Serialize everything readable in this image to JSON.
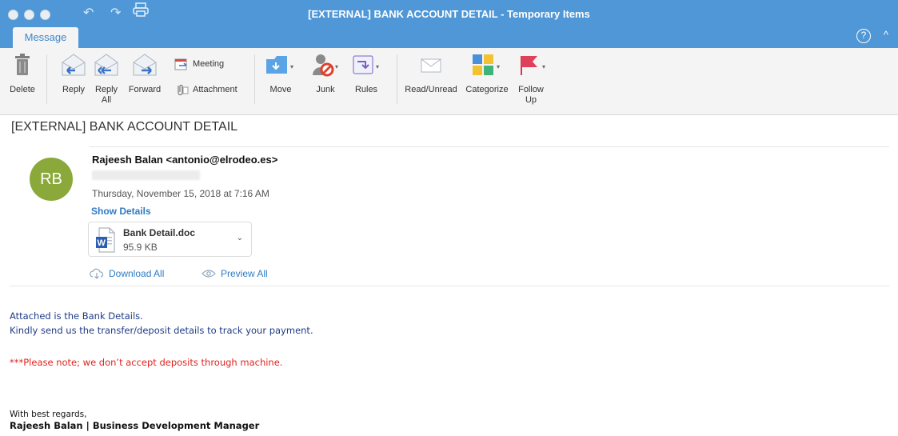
{
  "window": {
    "title": "[EXTERNAL] BANK ACCOUNT DETAIL - Temporary Items",
    "tab_label": "Message",
    "help_glyph": "?",
    "collapse_glyph": "^"
  },
  "ribbon": {
    "delete": "Delete",
    "reply": "Reply",
    "reply_all": "Reply All",
    "forward": "Forward",
    "meeting": "Meeting",
    "attachment": "Attachment",
    "move": "Move",
    "junk": "Junk",
    "rules": "Rules",
    "read_unread": "Read/Unread",
    "categorize": "Categorize",
    "follow_up": "Follow Up"
  },
  "message": {
    "subject": "[EXTERNAL] BANK ACCOUNT DETAIL",
    "avatar_initials": "RB",
    "sender": "Rajeesh Balan <antonio@elrodeo.es>",
    "date": "Thursday, November 15, 2018 at 7:16 AM",
    "show_details": "Show Details",
    "attachment_name": "Bank Detail.doc",
    "attachment_size": "95.9 KB",
    "download_all": "Download All",
    "preview_all": "Preview All"
  },
  "body": {
    "line1": "Attached is the Bank Details.",
    "line2": "Kindly send us the transfer/deposit details to track your payment.",
    "warning": "***Please note; we don’t accept deposits through machine.",
    "regards": "With best regards,",
    "signature": "Rajeesh Balan | Business Development Manager"
  },
  "colors": {
    "titlebar": "#4f97d6",
    "link": "#2e7bc4",
    "avatar": "#8ba93a",
    "warning": "#e0231f",
    "body_blue": "#1f3b86"
  }
}
